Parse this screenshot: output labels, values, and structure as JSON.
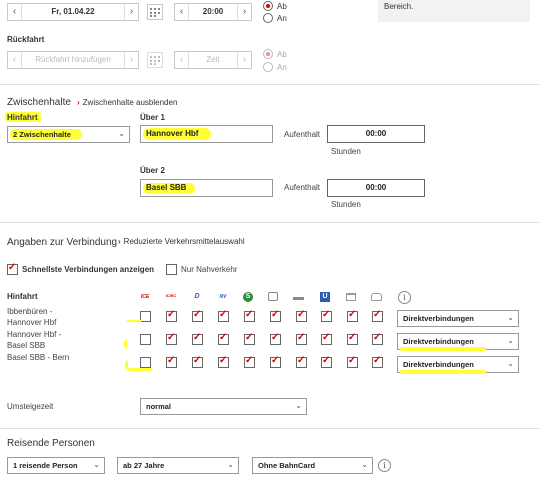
{
  "hinfahrt_date": {
    "value": "Fr, 01.04.22"
  },
  "hinfahrt_time": {
    "value": "20:00"
  },
  "hinfahrt_radios": [
    "Ab",
    "An"
  ],
  "info_text": "Bereich.",
  "rueckfahrt": {
    "heading": "Rückfahrt",
    "date_placeholder": "Rückfahrt hinzufügen",
    "time_placeholder": "Zeit",
    "radios": [
      "Ab",
      "An"
    ]
  },
  "zwischenhalte": {
    "title": "Zwischenhalte",
    "hide_link": "Zwischenhalte ausblenden",
    "hinfahrt_label": "Hinfahrt",
    "count_select": "2 Zwischenhalte",
    "via1_label": "Über 1",
    "via1_value": "Hannover Hbf",
    "via2_label": "Über 2",
    "via2_value": "Basel SBB",
    "aufenthalt_label": "Aufenthalt",
    "aufenthalt1": "00:00",
    "aufenthalt2": "00:00",
    "stunden": "Stunden"
  },
  "verbindung": {
    "title": "Angaben zur Verbindung",
    "link": "Reduzierte Verkehrsmittelauswahl",
    "fastest_label": "Schnellste Verbindungen anzeigen",
    "nahverkehr_label": "Nur Nahverkehr",
    "hinfahrt_label": "Hinfahrt",
    "transport_icons": [
      "ICE",
      "IC/EC",
      "D",
      "NV",
      "S",
      "bus-icon",
      "ship-icon",
      "U",
      "tram-icon",
      "taxi-icon"
    ],
    "segments": [
      {
        "label": "Ibbenbüren - Hannover Hbf",
        "select": "Direktverbindungen"
      },
      {
        "label": "Hannover Hbf - Basel SBB",
        "select": "Direktverbindungen"
      },
      {
        "label": "Basel SBB - Bern",
        "select": "Direktverbindungen"
      }
    ]
  },
  "umsteigezeit": {
    "label": "Umsteigezeit",
    "value": "normal"
  },
  "reisende": {
    "title": "Reisende Personen",
    "persons": "1 reisende Person",
    "age": "ab 27 Jahre",
    "card": "Ohne BahnCard"
  },
  "colors": {
    "accent": "#d40000",
    "highlight": "#ffff33"
  }
}
